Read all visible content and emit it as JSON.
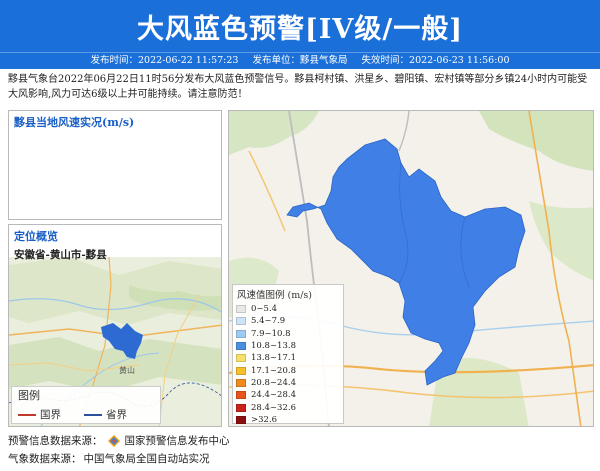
{
  "header": {
    "title": "大风蓝色预警[IV级/一般]",
    "issue_time_label": "发布时间：",
    "issue_time": "2022-06-22 11:57:23",
    "issuer_label": "发布单位：",
    "issuer": "黟县气象局",
    "expire_label": "失效时间：",
    "expire_time": "2022-06-23 11:56:00"
  },
  "description": "黟县气象台2022年06月22日11时56分发布大风蓝色预警信号。黟县柯村镇、洪星乡、碧阳镇、宏村镇等部分乡镇24小时内可能受大风影响,风力可达6级以上并可能持续。请注意防范！",
  "wind_panel": {
    "title": "黟县当地风速实况(m/s)"
  },
  "location_panel": {
    "title": "定位概览",
    "path": "安徽省-黄山市-黟县",
    "map_labels": [
      "黄山"
    ],
    "legend": {
      "title": "图例",
      "country_border": "国界",
      "province_border": "省界",
      "country_color": "#c0392b",
      "province_color": "#2c4f9e"
    }
  },
  "wind_scale": {
    "title": "风速值图例 (m/s)",
    "items": [
      {
        "label": "0~5.4",
        "color": "#e8e8e8"
      },
      {
        "label": "5.4~7.9",
        "color": "#cfe3f7"
      },
      {
        "label": "7.9~10.8",
        "color": "#9ecbf2"
      },
      {
        "label": "10.8~13.8",
        "color": "#4a8fe0"
      },
      {
        "label": "13.8~17.1",
        "color": "#f7e06a"
      },
      {
        "label": "17.1~20.8",
        "color": "#f5c02a"
      },
      {
        "label": "20.8~24.4",
        "color": "#f08a1c"
      },
      {
        "label": "24.4~28.4",
        "color": "#e8521b"
      },
      {
        "label": "28.4~32.6",
        "color": "#c9221b"
      },
      {
        "label": ">32.6",
        "color": "#8b0f0f"
      }
    ]
  },
  "sources": {
    "warning_label": "预警信息数据来源：",
    "warning_source": "国家预警信息发布中心",
    "weather_label": "气象数据来源：",
    "weather_source": "中国气象局全国自动站实况"
  },
  "colors": {
    "header_bg": "#1b6fd8",
    "warning_area": "#3f7fe6"
  }
}
